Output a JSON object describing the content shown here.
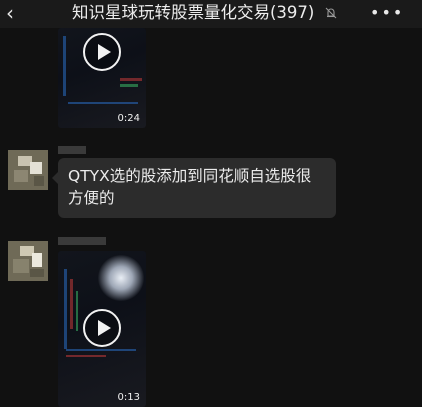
{
  "header": {
    "back_icon": "chevron-left-icon",
    "title": "知识星球玩转股票量化交易(397)",
    "mute_icon": "bell-off-icon",
    "more_label": "•••"
  },
  "messages": [
    {
      "type": "video",
      "duration": "0:24"
    },
    {
      "type": "text",
      "text": "QTYX选的股添加到同花顺自选股很方便的"
    },
    {
      "type": "video",
      "duration": "0:13"
    }
  ],
  "colors": {
    "background": "#111111",
    "bubble": "#2c2c2c",
    "text": "#ececec"
  }
}
